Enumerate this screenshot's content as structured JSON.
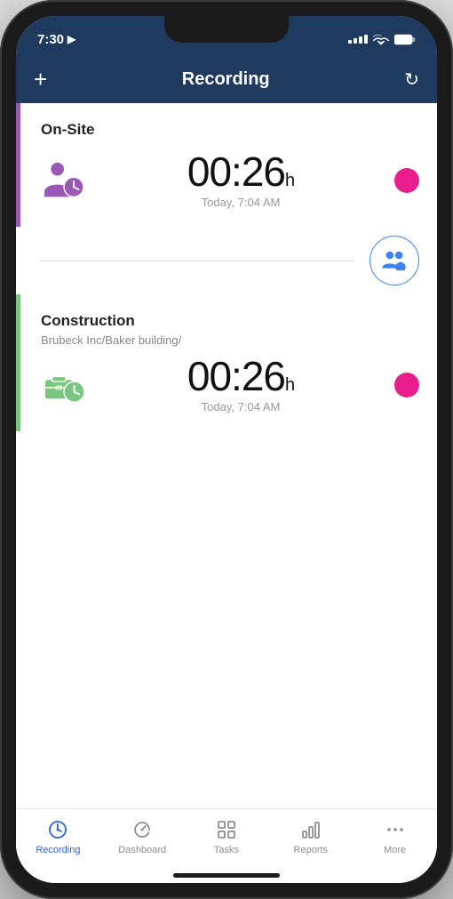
{
  "status_bar": {
    "time": "7:30",
    "location_arrow": "›"
  },
  "nav": {
    "title": "Recording",
    "plus_label": "+",
    "refresh_label": "↺"
  },
  "cards": [
    {
      "id": "on-site",
      "label": "On-Site",
      "sublabel": "",
      "accent": "purple",
      "timer": "00:26",
      "timer_unit": "h",
      "timer_sub": "Today, 7:04 AM",
      "icon_type": "person-clock"
    },
    {
      "id": "construction",
      "label": "Construction",
      "sublabel": "Brubeck Inc/Baker building/",
      "accent": "green",
      "timer": "00:26",
      "timer_unit": "h",
      "timer_sub": "Today, 7:04 AM",
      "icon_type": "briefcase-clock"
    }
  ],
  "tabs": [
    {
      "id": "recording",
      "label": "Recording",
      "active": true,
      "icon": "timer"
    },
    {
      "id": "dashboard",
      "label": "Dashboard",
      "active": false,
      "icon": "chart"
    },
    {
      "id": "tasks",
      "label": "Tasks",
      "active": false,
      "icon": "grid"
    },
    {
      "id": "reports",
      "label": "Reports",
      "active": false,
      "icon": "bar-chart"
    },
    {
      "id": "more",
      "label": "More",
      "active": false,
      "icon": "dots"
    }
  ]
}
